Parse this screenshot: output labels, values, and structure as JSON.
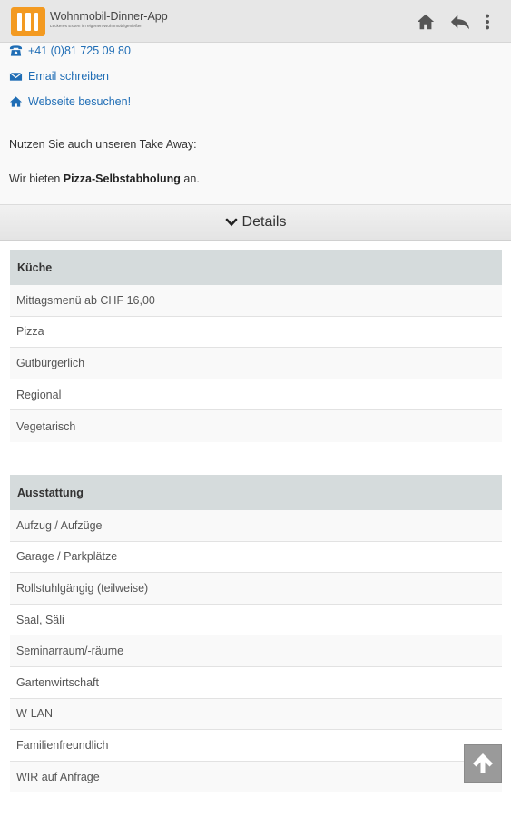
{
  "appbar": {
    "title": "Wohnmobil-Dinner-App",
    "subtitle": "Leckeres Essen im eigenen Wohnmobilgenießen",
    "icons": [
      "home-icon",
      "back-arrow-icon",
      "more-vertical-icon"
    ]
  },
  "contact": {
    "phone": "+41 (0)81 725 09 80",
    "email_label": "Email schreiben",
    "website_label": "Webseite besuchen!"
  },
  "info": {
    "takeaway_text": "Nutzen Sie auch unseren Take Away:",
    "offer_prefix": "Wir bieten ",
    "offer_bold": "Pizza-Selbstabholung",
    "offer_suffix": " an."
  },
  "details": {
    "label": "Details"
  },
  "kueche": {
    "title": "Küche",
    "items": [
      "Mittagsmenü ab CHF 16,00",
      "Pizza",
      "Gutbürgerlich",
      "Regional",
      "Vegetarisch"
    ]
  },
  "ausstattung": {
    "title": "Ausstattung",
    "items": [
      "Aufzug / Aufzüge",
      "Garage / Parkplätze",
      "Rollstuhlgängig (teilweise)",
      "Saal, Säli",
      "Seminarraum/-räume",
      "Gartenwirtschaft",
      "W-LAN",
      "Familienfreundlich",
      "WIR auf Anfrage"
    ]
  },
  "colors": {
    "accent": "#f39a21",
    "link": "#1f6db5",
    "header_bg": "#d5dbdc"
  }
}
